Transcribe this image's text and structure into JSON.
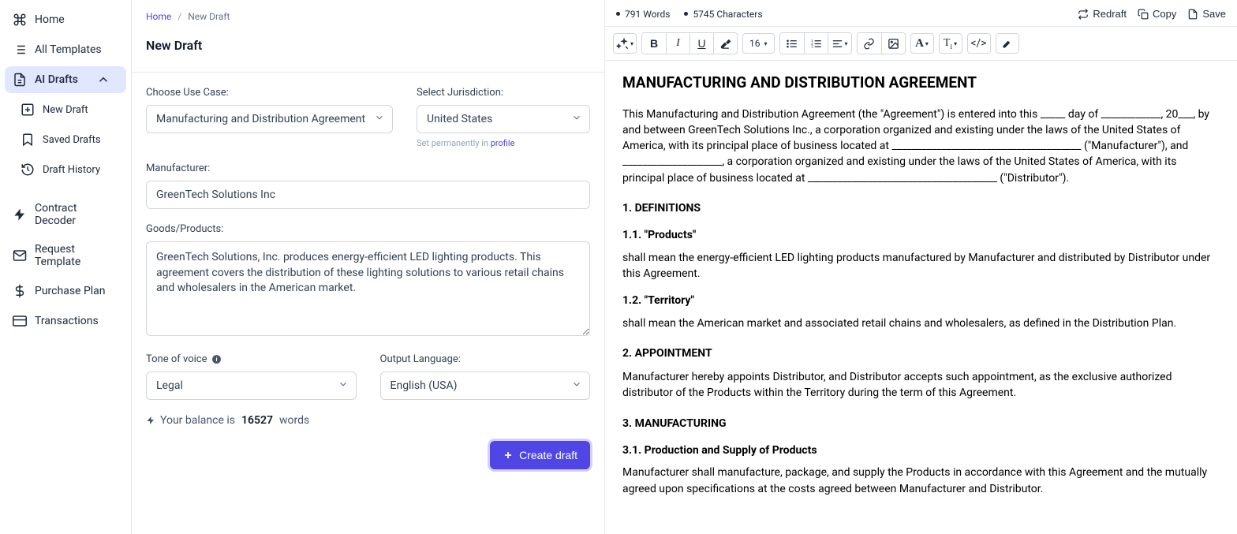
{
  "sidebar": {
    "home": "Home",
    "all_templates": "All Templates",
    "ai_drafts": "AI Drafts",
    "new_draft": "New Draft",
    "saved_drafts": "Saved Drafts",
    "draft_history": "Draft History",
    "contract_decoder": "Contract Decoder",
    "request_template": "Request Template",
    "purchase_plan": "Purchase Plan",
    "transactions": "Transactions"
  },
  "breadcrumb": {
    "home": "Home",
    "current": "New Draft"
  },
  "page_title": "New Draft",
  "form": {
    "use_case_label": "Choose Use Case:",
    "use_case_value": "Manufacturing and Distribution Agreement",
    "jurisdiction_label": "Select Jurisdiction:",
    "jurisdiction_value": "United States",
    "jurisdiction_subtext_prefix": "Set permanently in ",
    "jurisdiction_subtext_link": "profile",
    "manufacturer_label": "Manufacturer:",
    "manufacturer_value": "GreenTech Solutions Inc",
    "goods_label": "Goods/Products:",
    "goods_value": "GreenTech Solutions, Inc. produces energy-efficient LED lighting products. This agreement covers the distribution of these lighting solutions to various retail chains and wholesalers in the American market.",
    "tone_label": "Tone of voice",
    "tone_value": "Legal",
    "lang_label": "Output Language:",
    "lang_value": "English (USA)",
    "balance_prefix": "Your balance is",
    "balance_value": "16527",
    "balance_suffix": "words",
    "create_button": "Create draft"
  },
  "editor": {
    "words_label": "791 Words",
    "chars_label": "5745 Characters",
    "redraft": "Redraft",
    "copy": "Copy",
    "save": "Save",
    "font_size": "16",
    "doc": {
      "title": "MANUFACTURING AND DISTRIBUTION AGREEMENT",
      "intro": "This Manufacturing and Distribution Agreement (the \"Agreement\") is entered into this _____ day of ____________, 20___, by and between GreenTech Solutions Inc., a corporation organized and existing under the laws of the United States of America, with its principal place of business located at ______________________________________ (\"Manufacturer\"), and ____________________, a corporation organized and existing under the laws of the United States of America, with its principal place of business located at ______________________________________ (\"Distributor\").",
      "h_def": "1. DEFINITIONS",
      "h_products": "1.1. \"Products\"",
      "p_products": "shall mean the energy-efficient LED lighting products manufactured by Manufacturer and distributed by Distributor under this Agreement.",
      "h_territory": "1.2. \"Territory\"",
      "p_territory": "shall mean the American market and associated retail chains and wholesalers, as defined in the Distribution Plan.",
      "h_appoint": "2. APPOINTMENT",
      "p_appoint": "Manufacturer hereby appoints Distributor, and Distributor accepts such appointment, as the exclusive authorized distributor of the Products within the Territory during the term of this Agreement.",
      "h_mfg": "3. MANUFACTURING",
      "h_prod_supply": "3.1. Production and Supply of Products",
      "p_prod_supply": "Manufacturer shall manufacture, package, and supply the Products in accordance with this Agreement and the mutually agreed upon specifications at the costs agreed between Manufacturer and Distributor."
    }
  }
}
